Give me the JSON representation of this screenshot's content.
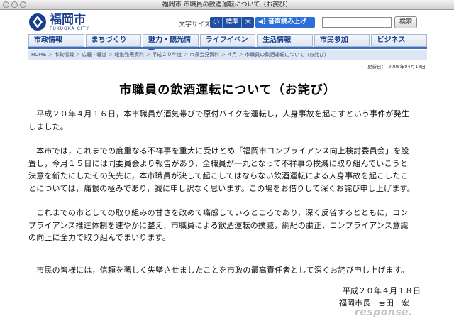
{
  "window": {
    "title": "福岡市 市職員の飲酒運転について（お詫び）"
  },
  "header": {
    "logo_text": "福岡市",
    "logo_sub": "FUKUOKA CITY",
    "textsize_label": "文字サイズ",
    "textsize_options": [
      "小",
      "標準",
      "大"
    ],
    "voice_button": "音声読み上げ",
    "search_value": "",
    "search_button": "検索"
  },
  "nav": {
    "items": [
      "市政情報",
      "まちづくり",
      "魅力・観光情報",
      "ライフイベント",
      "生活情報",
      "市民参加",
      "ビジネス"
    ]
  },
  "breadcrumb": [
    "HOME",
    "市政情報",
    "広報・報道",
    "報道発表資料",
    "平成２０年度",
    "市長会見資料",
    "４月",
    "市職員の飲酒運転について（お詫び）"
  ],
  "updated": "更新日：　2008年04月18日",
  "article": {
    "title": "市職員の飲酒運転について（お詫び）",
    "p1_l1": "　平成２０年４月１６日，本市職員が酒気帯びで原付バイクを運転し，人身事故を起こすという事件が発生",
    "p1_l2": "しました。",
    "p2_l1": "　本市では，これまでの度重なる不祥事を重大に受けとめ「福岡市コンプライアンス向上検討委員会」を設",
    "p2_l2": "置し，今月１５日には同委員会より報告があり，全職員が一丸となって不祥事の撲滅に取り組んでいこうと",
    "p2_l3": "決意を新たにしたその矢先に，本市職員が決して起こしてはならない飲酒運転による人身事故を起こしたこ",
    "p2_l4": "とについては，痛恨の極みであり，誠に申し訳なく思います。この場をお借りして深くお詫び申し上げます。",
    "p3_l1": "　これまでの市としての取り組みの甘さを改めて痛感しているところであり，深く反省するとともに，コン",
    "p3_l2": "プライアンス推進体制を速やかに整え，市職員による飲酒運転の撲滅，綱紀の粛正，コンプライアンス意識",
    "p3_l3": "の向上に全力で取り組んでまいります。",
    "p4_l1": "　市民の皆様には，信頼を著しく失墜させましたことを市政の最高責任者として深くお詫び申し上げます。",
    "date": "平成２０年４月１８日",
    "signature": "福岡市長　吉田　宏"
  },
  "watermark": "response."
}
